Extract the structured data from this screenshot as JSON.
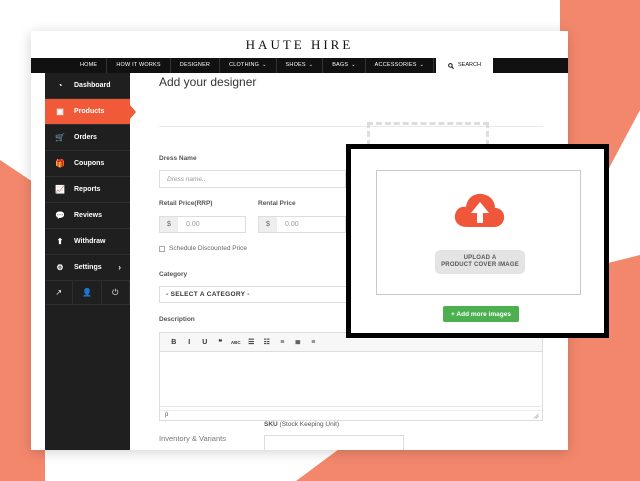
{
  "brand": {
    "name": "HAUTE HIRE"
  },
  "topnav": {
    "items": [
      {
        "label": "HOME",
        "has_menu": false
      },
      {
        "label": "HOW IT WORKS",
        "has_menu": false
      },
      {
        "label": "DESIGNER",
        "has_menu": false
      },
      {
        "label": "CLOTHING",
        "has_menu": true
      },
      {
        "label": "SHOES",
        "has_menu": true
      },
      {
        "label": "BAGS",
        "has_menu": true
      },
      {
        "label": "ACCESSORIES",
        "has_menu": true
      }
    ],
    "search_label": "SEARCH",
    "chevron_glyph": "⌄"
  },
  "sidebar": {
    "items": [
      {
        "label": "Dashboard",
        "icon": "dashboard-icon",
        "glyph": "◔",
        "active": false
      },
      {
        "label": "Products",
        "icon": "briefcase-icon",
        "glyph": "▣",
        "active": true
      },
      {
        "label": "Orders",
        "icon": "cart-icon",
        "glyph": "🛒",
        "active": false
      },
      {
        "label": "Coupons",
        "icon": "gift-icon",
        "glyph": "🎁",
        "active": false
      },
      {
        "label": "Reports",
        "icon": "chart-icon",
        "glyph": "📈",
        "active": false
      },
      {
        "label": "Reviews",
        "icon": "comments-icon",
        "glyph": "💬",
        "active": false
      },
      {
        "label": "Withdraw",
        "icon": "upload-icon",
        "glyph": "⬆",
        "active": false
      },
      {
        "label": "Settings",
        "icon": "gear-icon",
        "glyph": "⚙",
        "active": false,
        "arrow": "›"
      }
    ],
    "bottom_icons": [
      {
        "icon": "external-link-icon",
        "glyph": "↗"
      },
      {
        "icon": "user-icon",
        "glyph": "👤"
      },
      {
        "icon": "power-icon",
        "glyph": "⏻"
      }
    ]
  },
  "form": {
    "title": "Add your designer",
    "dress_name_label": "Dress Name",
    "dress_name_placeholder": "Dress name..",
    "retail_label": "Retail Price(RRP)",
    "rental_label": "Rental Price",
    "currency": "$",
    "price_placeholder": "0.00",
    "schedule_label": "Schedule Discounted Price",
    "category_label": "Category",
    "category_value": "- SELECT A CATEGORY -",
    "description_label": "Description",
    "toolbar_glyphs": [
      "B",
      "I",
      "U",
      "❝",
      "ABC",
      "☰",
      "☷",
      "≡",
      "≣",
      "≡"
    ],
    "editor_status": "p",
    "inventory_label": "Inventory & Variants",
    "sku_label": "SKU",
    "sku_hint": "(Stock Keeping Unit)"
  },
  "upload": {
    "button_line1": "UPLOAD A",
    "button_line2": "PRODUCT COVER IMAGE",
    "add_more_label": "+ Add more images",
    "cloud_color": "#f0573a"
  },
  "colors": {
    "accent": "#f05a39",
    "background_shape": "#f3876c",
    "sidebar": "#1f1f1f",
    "add_more": "#4caf50"
  }
}
